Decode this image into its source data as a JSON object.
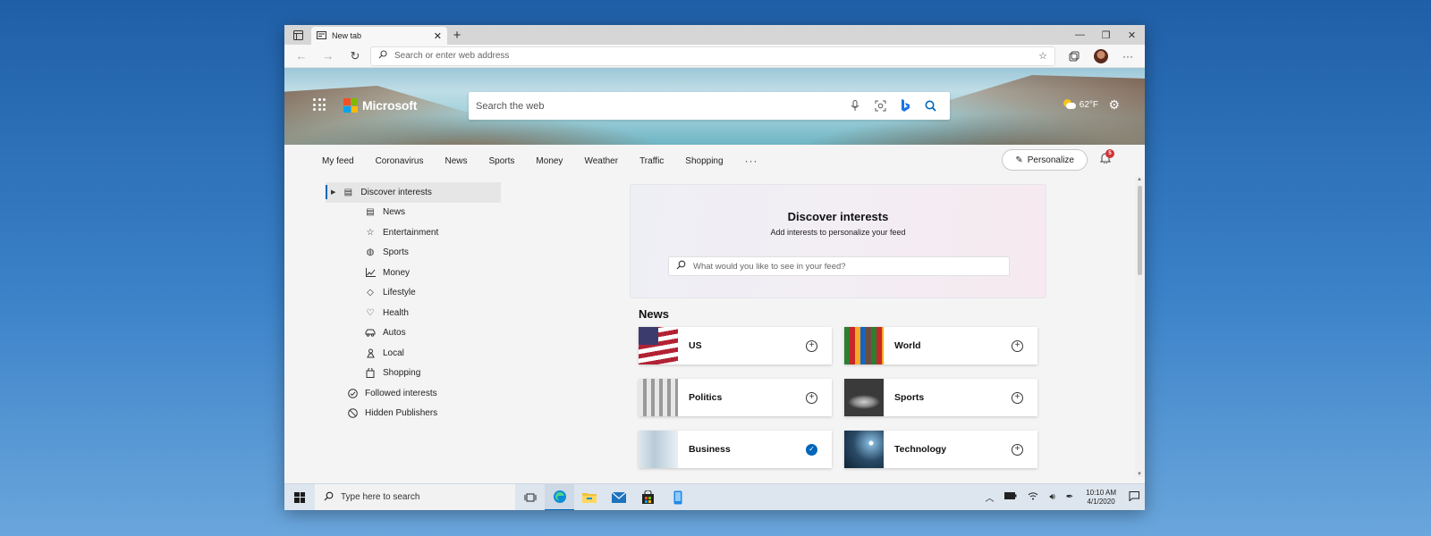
{
  "browser": {
    "tab_title": "New tab",
    "address_placeholder": "Search or enter web address"
  },
  "hero": {
    "brand": "Microsoft",
    "search_placeholder": "Search the web",
    "weather_temp": "62°F",
    "logo_colors": [
      "#f25022",
      "#7fba00",
      "#00a4ef",
      "#ffb900"
    ]
  },
  "categories": [
    "My feed",
    "Coronavirus",
    "News",
    "Sports",
    "Money",
    "Weather",
    "Traffic",
    "Shopping"
  ],
  "more_label": "···",
  "personalize_label": "Personalize",
  "notification_count": "5",
  "sidebar": {
    "discover": "Discover interests",
    "children": [
      {
        "label": "News",
        "icon": "newspaper-icon"
      },
      {
        "label": "Entertainment",
        "icon": "star-icon"
      },
      {
        "label": "Sports",
        "icon": "ball-icon"
      },
      {
        "label": "Money",
        "icon": "chart-icon"
      },
      {
        "label": "Lifestyle",
        "icon": "diamond-icon"
      },
      {
        "label": "Health",
        "icon": "heart-icon"
      },
      {
        "label": "Autos",
        "icon": "car-icon"
      },
      {
        "label": "Local",
        "icon": "person-pin-icon"
      },
      {
        "label": "Shopping",
        "icon": "bag-icon"
      }
    ],
    "followed": "Followed interests",
    "hidden": "Hidden Publishers"
  },
  "discover": {
    "title": "Discover interests",
    "subtitle": "Add interests to personalize your feed",
    "search_placeholder": "What would you like to see in your feed?"
  },
  "news": {
    "heading": "News",
    "tiles": [
      {
        "label": "US",
        "followed": false
      },
      {
        "label": "World",
        "followed": false
      },
      {
        "label": "Politics",
        "followed": false
      },
      {
        "label": "Sports",
        "followed": false
      },
      {
        "label": "Business",
        "followed": true
      },
      {
        "label": "Technology",
        "followed": false
      }
    ]
  },
  "taskbar": {
    "search_placeholder": "Type here to search",
    "time": "10:10 AM",
    "date": "4/1/2020"
  },
  "accent_color": "#0067b8"
}
